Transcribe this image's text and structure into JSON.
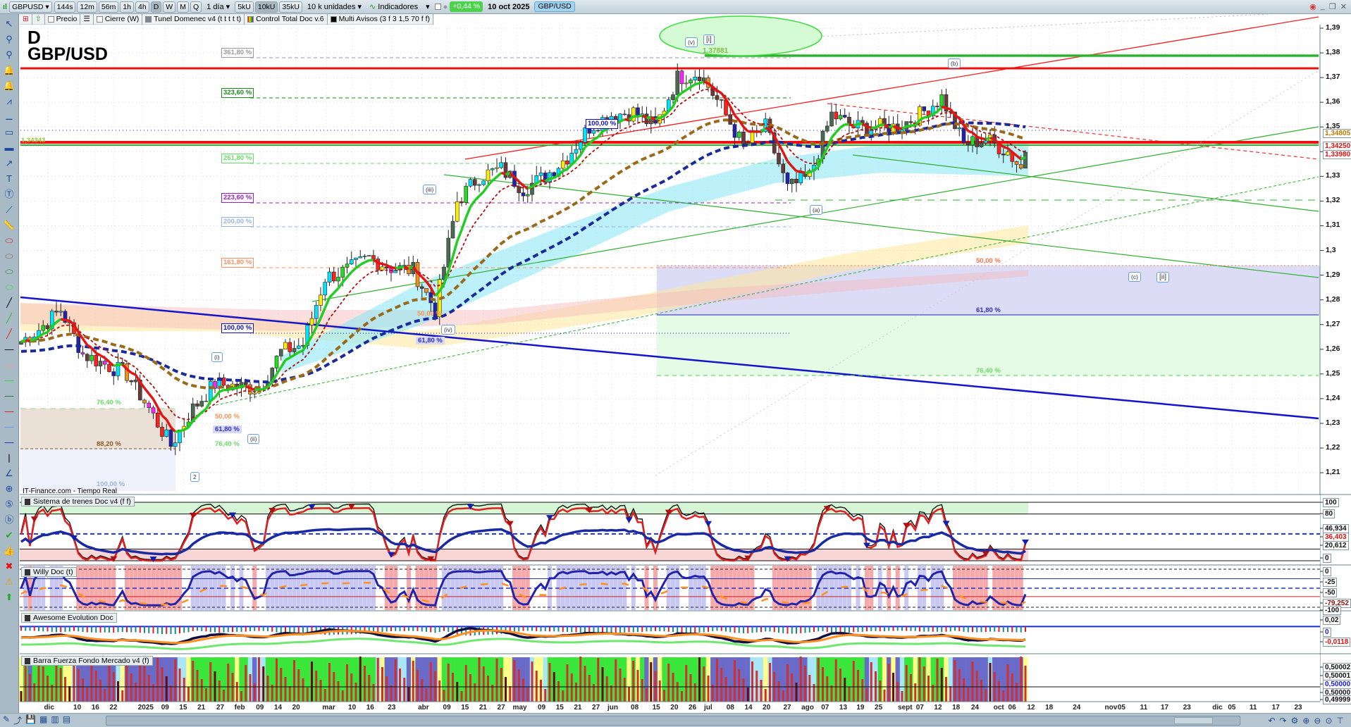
{
  "toolbar": {
    "symbol": "GBPUSD",
    "timeframes": [
      "144s",
      "12m",
      "56m",
      "1h",
      "4h",
      "D",
      "W",
      "M",
      "Q"
    ],
    "selected_timeframe": "D",
    "period": "1 día",
    "units": [
      "5kU",
      "10kU",
      "35kU"
    ],
    "selected_unit": "10kU",
    "units_select": "10 k unidades",
    "indicators": "Indicadores",
    "change": "+0,44 %",
    "date": "10 oct 2025",
    "pair": "GBP/USD"
  },
  "legend": {
    "items": [
      "Precio",
      "Cierre (W)",
      "Tunel Domenec v4 (t t t t t)",
      "Control Total Doc v.6",
      "Multi Avisos (3 f 3 1,5 70 f f)"
    ]
  },
  "left_tools": [
    "pointer-icon",
    "zoom-icon",
    "zoom-area-icon",
    "alert-cursor-icon",
    "alert-bell-icon",
    "fibonacci-icon",
    "fib-line-icon",
    "rectangle-icon",
    "filled-rectangle-icon",
    "arrow-icon",
    "text-icon",
    "callout-icon",
    "segment-icon",
    "ruler-icon",
    "ellipse-red-icon",
    "ellipse-brown-icon",
    "ellipse-green-icon",
    "ellipse-lightgreen-icon",
    "line-black-icon",
    "line-green-icon",
    "line-red-icon",
    "hline-black-icon",
    "hline-salmon-icon",
    "hline-green-icon",
    "hline-darkgreen-icon",
    "hline-red-icon",
    "hline-blue-icon",
    "hline-navy-icon",
    "vline-icon",
    "angle-icon",
    "target-icon",
    "elliott-numbers-icon",
    "elliott-letters-icon",
    "check-icon",
    "thumbs-up-icon",
    "cross-icon",
    "warning-icon",
    "arrow-up-icon"
  ],
  "chart": {
    "timeframe_label": "D",
    "title": "GBP/USD",
    "source": "IT-Finance.com - Tiempo Real",
    "price_ticks": [
      "1,39",
      "1,38",
      "1,37",
      "1,36",
      "1,35",
      "1,34",
      "1,33",
      "1,32",
      "1,31",
      "1,3",
      "1,29",
      "1,28",
      "1,27",
      "1,26",
      "1,25",
      "1,24",
      "1,23",
      "1,22",
      "1,21"
    ],
    "price_boxes": [
      {
        "value": "1,34805",
        "color": "#c07a00"
      },
      {
        "value": "1,34250",
        "color": "#e01010"
      },
      {
        "value": "1,33980",
        "color": "#e01010"
      }
    ],
    "level_label": "1,34343",
    "high_label": "1,37881",
    "fib_labels": [
      {
        "text": "361,80 %",
        "color": "#999999"
      },
      {
        "text": "323,60 %",
        "color": "#1a8a1a"
      },
      {
        "text": "261,80 %",
        "color": "#66dd66"
      },
      {
        "text": "223,60 %",
        "color": "#9a20c0"
      },
      {
        "text": "200,00 %",
        "color": "#9ab4e0"
      },
      {
        "text": "161,80 %",
        "color": "#ff9060"
      },
      {
        "text": "100,00 %",
        "color": "#1010c0"
      },
      {
        "text": "100,00 %",
        "color": "#1010c0"
      }
    ],
    "zone_labels": [
      {
        "text": "50,00 %",
        "color": "#ff7050"
      },
      {
        "text": "61,80 %",
        "color": "#3030c0"
      },
      {
        "text": "76,40 %",
        "color": "#66dd66"
      },
      {
        "text": "76,40 %",
        "color": "#66dd66"
      },
      {
        "text": "88,20 %",
        "color": "#8a5a20"
      },
      {
        "text": "100,00 %",
        "color": "#9ab4e0"
      },
      {
        "text": "50,00 %",
        "color": "#ff9050"
      },
      {
        "text": "61,80 %",
        "color": "#3030c0"
      },
      {
        "text": "76,40 %",
        "color": "#66dd66"
      },
      {
        "text": "50,00 %",
        "color": "#ff9050"
      },
      {
        "text": "61,80 %",
        "color": "#3030c0"
      }
    ],
    "wave_labels": [
      "(v)",
      "[i]",
      "(b)",
      "(a)",
      "(c)",
      "[ii]",
      "(iii)",
      "(i)",
      "(ii)",
      "2",
      "(iv)"
    ]
  },
  "panels": [
    {
      "title": "Sistema de trenes Doc v4 (f f)",
      "axis": [
        "100",
        "80",
        "46,934",
        "36,403",
        "20,612",
        "0"
      ]
    },
    {
      "title": "Willy Doc (t)",
      "axis": [
        "0",
        "-25",
        "-50",
        "-79,252",
        "-100"
      ]
    },
    {
      "title": "Awesome Evolution Doc",
      "axis": [
        "0,02",
        "0",
        "-0,0118"
      ]
    },
    {
      "title": "Barra Fuerza Fondo Mercado v4 (f)",
      "axis": [
        "0,50002",
        "0,50001",
        "0,50000",
        "0,50000",
        "0,49999"
      ]
    }
  ],
  "x_axis_labels": [
    "dic",
    "10",
    "16",
    "22",
    "2025",
    "09",
    "15",
    "21",
    "27",
    "feb",
    "09",
    "14",
    "20",
    "mar",
    "10",
    "16",
    "23",
    "abr",
    "09",
    "15",
    "21",
    "27",
    "may",
    "09",
    "15",
    "21",
    "27",
    "jun",
    "08",
    "15",
    "20",
    "26",
    "jul",
    "08",
    "14",
    "20",
    "27",
    "ago",
    "07",
    "13",
    "19",
    "25",
    "sept",
    "07",
    "12",
    "18",
    "24",
    "oct",
    "06",
    "12",
    "18",
    "24",
    "nov",
    "05",
    "11",
    "17",
    "23",
    "dic",
    "05",
    "11",
    "17",
    "23"
  ],
  "chart_data": {
    "type": "candlestick",
    "symbol": "GBP/USD",
    "timeframe": "D",
    "ylim": [
      1.205,
      1.395
    ],
    "weekly_close": [
      [
        "2024-11-25",
        1.262
      ],
      [
        "2024-12-02",
        1.268
      ],
      [
        "2024-12-09",
        1.276
      ],
      [
        "2024-12-16",
        1.258
      ],
      [
        "2024-12-23",
        1.254
      ],
      [
        "2024-12-30",
        1.25
      ],
      [
        "2025-01-06",
        1.236
      ],
      [
        "2025-01-13",
        1.221
      ],
      [
        "2025-01-20",
        1.236
      ],
      [
        "2025-01-27",
        1.246
      ],
      [
        "2025-02-03",
        1.245
      ],
      [
        "2025-02-10",
        1.244
      ],
      [
        "2025-02-17",
        1.259
      ],
      [
        "2025-02-24",
        1.262
      ],
      [
        "2025-03-03",
        1.289
      ],
      [
        "2025-03-10",
        1.292
      ],
      [
        "2025-03-17",
        1.297
      ],
      [
        "2025-03-24",
        1.293
      ],
      [
        "2025-03-31",
        1.292
      ],
      [
        "2025-04-07",
        1.276
      ],
      [
        "2025-04-14",
        1.32
      ],
      [
        "2025-04-21",
        1.33
      ],
      [
        "2025-04-28",
        1.333
      ],
      [
        "2025-05-05",
        1.325
      ],
      [
        "2025-05-12",
        1.33
      ],
      [
        "2025-05-19",
        1.338
      ],
      [
        "2025-05-26",
        1.35
      ],
      [
        "2025-06-02",
        1.355
      ],
      [
        "2025-06-09",
        1.356
      ],
      [
        "2025-06-16",
        1.35
      ],
      [
        "2025-06-23",
        1.37
      ],
      [
        "2025-06-30",
        1.372
      ],
      [
        "2025-07-07",
        1.358
      ],
      [
        "2025-07-14",
        1.342
      ],
      [
        "2025-07-21",
        1.35
      ],
      [
        "2025-07-28",
        1.325
      ],
      [
        "2025-08-04",
        1.33
      ],
      [
        "2025-08-11",
        1.355
      ],
      [
        "2025-08-18",
        1.35
      ],
      [
        "2025-08-25",
        1.35
      ],
      [
        "2025-09-01",
        1.35
      ],
      [
        "2025-09-08",
        1.355
      ],
      [
        "2025-09-15",
        1.362
      ],
      [
        "2025-09-22",
        1.343
      ],
      [
        "2025-09-29",
        1.345
      ],
      [
        "2025-10-06",
        1.34
      ],
      [
        "2025-10-10",
        1.331
      ]
    ],
    "high": 1.37881,
    "last": 1.3398
  },
  "bottom_tools": [
    "pencil-icon",
    "share-icon",
    "save-icon",
    "calendar-icon",
    "bars-icon",
    "template-icon",
    "undo-icon",
    "redo-icon",
    "settings-icon",
    "zoom-in-icon",
    "zoom-out-icon",
    "zoom-fit-icon",
    "measure-icon"
  ]
}
